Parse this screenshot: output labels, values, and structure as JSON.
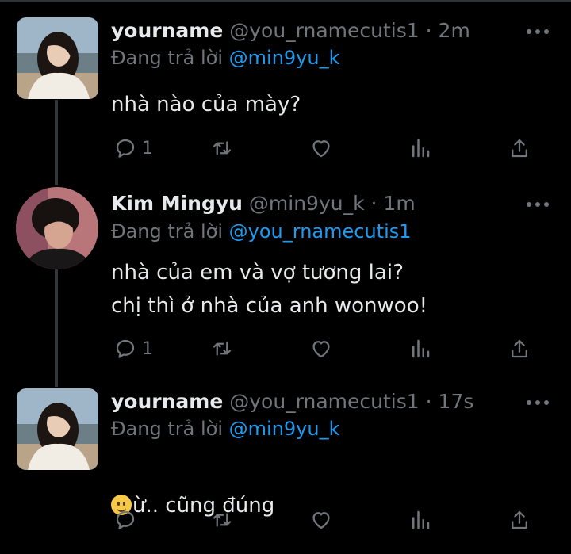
{
  "tweets": [
    {
      "name": "yourname",
      "handle": "@you_rnamecutis1",
      "dot": "·",
      "time": "2m",
      "reply_prefix": "Đang trả lời",
      "reply_to": "@min9yu_k",
      "text": "nhà nào của mày?",
      "reply_count": "1",
      "avatar_icon": "girl-profile-photo"
    },
    {
      "name": "Kim Mingyu",
      "handle": "@min9yu_k",
      "dot": "·",
      "time": "1m",
      "reply_prefix": "Đang trả lời",
      "reply_to": "@you_rnamecutis1",
      "text": "nhà của em và vợ tương lai?\nchị thì ở nhà của anh wonwoo!",
      "reply_count": "1",
      "avatar_icon": "boy-profile-photo"
    },
    {
      "name": "yourname",
      "handle": "@you_rnamecutis1",
      "dot": "·",
      "time": "17s",
      "reply_prefix": "Đang trả lời",
      "reply_to": "@min9yu_k",
      "text_emoji": "slightly-smiling-face",
      "text": "ừ.. cũng đúng",
      "reply_count": "",
      "avatar_icon": "girl-profile-photo"
    }
  ],
  "colors": {
    "background": "#000000",
    "text": "#e7e9ea",
    "muted": "#71767b",
    "link": "#1d9bf0"
  },
  "action_icons": [
    "reply-icon",
    "retweet-icon",
    "like-icon",
    "views-icon",
    "share-icon"
  ]
}
